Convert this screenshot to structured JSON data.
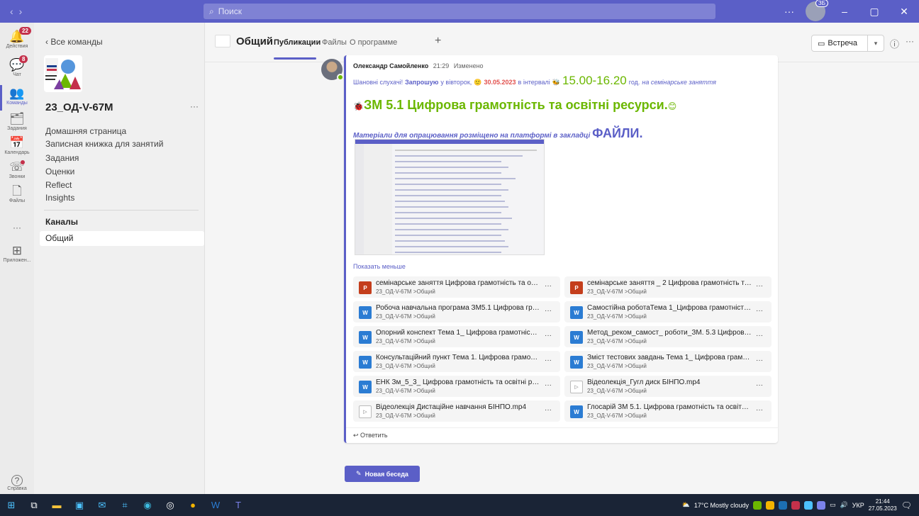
{
  "search": {
    "placeholder": "Поиск"
  },
  "titlebar": {
    "more": "···",
    "avatar_badge": "ЗБ",
    "minimize": "–",
    "maximize": "▢",
    "close": "✕",
    "back": "‹",
    "forward": "›"
  },
  "appbar": [
    {
      "label": "Действия",
      "icon": "bell-icon",
      "glyph": "🔔",
      "count": "22"
    },
    {
      "label": "Чат",
      "icon": "chat-icon",
      "glyph": "💬",
      "count": "8"
    },
    {
      "label": "Команды",
      "icon": "teams-icon",
      "glyph": "👥",
      "active": true
    },
    {
      "label": "Задания",
      "icon": "assignments-icon",
      "glyph": "🗂"
    },
    {
      "label": "Календарь",
      "icon": "calendar-icon",
      "glyph": "📅"
    },
    {
      "label": "Звонки",
      "icon": "phone-icon",
      "glyph": "☏",
      "dot": true
    },
    {
      "label": "Файлы",
      "icon": "file-icon",
      "glyph": "🗋"
    },
    {
      "label": "···",
      "icon": "more-icon",
      "glyph": ""
    },
    {
      "label": "Приложен...",
      "icon": "apps-icon",
      "glyph": "⊞"
    },
    {
      "label": "Справка",
      "icon": "help-icon",
      "glyph": "?"
    }
  ],
  "sidebar": {
    "back": "Все команды",
    "team_name": "23_ОД-V-67М",
    "more": "···",
    "links": [
      "Домашняя страница",
      "Записная книжка для занятий",
      "Задания",
      "Оценки",
      "Reflect",
      "Insights"
    ],
    "channels_heading": "Каналы",
    "channel": "Общий"
  },
  "header": {
    "title": "Общий",
    "tabs": [
      "Публикации",
      "Файлы",
      "О программе"
    ],
    "add": "+",
    "meet": "Встреча",
    "info": "ⓘ",
    "more": "···"
  },
  "message": {
    "author": "Олександр Самойленко",
    "time": "21:29",
    "edited": "Изменено",
    "greeting": "Шановні слухачі!",
    "invite": "Запрошую",
    "on": "у вівторок,",
    "date": "30.05.2023",
    "in": "в інтервалі",
    "hours": "15.00-16.20",
    "hour_suffix": "год.",
    "session": "на семінарське заняття",
    "title": "ЗМ 5.1 Цифрова грамотність та освітні ресурси.",
    "materials": "Матеріали для опрацювання розміщено на платформі в закладці",
    "files_word": "ФАЙЛИ.",
    "show_less": "Показать меньше",
    "reply": "Ответить"
  },
  "files": [
    {
      "type": "ppt",
      "name": "семінарське заняття Цифрова грамотність та осві...",
      "path": "23_ОД-V-67М >Общий"
    },
    {
      "type": "ppt",
      "name": "семінарське заняття _ 2 Цифрова грамотність та о...",
      "path": "23_ОД-V-67М >Общий"
    },
    {
      "type": "word",
      "name": "Робоча навчальна програма ЗМ5.1 Цифрова грам...",
      "path": "23_ОД-V-67М >Общий"
    },
    {
      "type": "word",
      "name": "Самостійна роботаТема 1_Цифрова грамотність т...",
      "path": "23_ОД-V-67М >Общий"
    },
    {
      "type": "word",
      "name": "Опорний конспект Тема 1_ Цифрова грамотність т...",
      "path": "23_ОД-V-67М >Общий"
    },
    {
      "type": "word",
      "name": "Метод_реком_самост_ роботи_ЗМ. 5.3 Цифрова г...",
      "path": "23_ОД-V-67М >Общий"
    },
    {
      "type": "word",
      "name": "Консультаційний пункт Тема 1. Цифрова грамотні...",
      "path": "23_ОД-V-67М >Общий"
    },
    {
      "type": "word",
      "name": "Зміст тестових завдань Тема 1_ Цифрова грамотні...",
      "path": "23_ОД-V-67М >Общий"
    },
    {
      "type": "word",
      "name": "ЕНК Зм_5_3_ Цифрова грамотність та освітні ресу...",
      "path": "23_ОД-V-67М >Общий"
    },
    {
      "type": "vid",
      "name": "Відеолекція_Гугл диск БІНПО.mp4",
      "path": "23_ОД-V-67М >Общий"
    },
    {
      "type": "vid",
      "name": "Відеолекція Дистаційне навчання БІНПО.mp4",
      "path": "23_ОД-V-67М >Общий"
    },
    {
      "type": "word",
      "name": "Глосарій ЗМ 5.1. Цифрова грамотність та освітні р...",
      "path": "23_ОД-V-67М >Общий"
    }
  ],
  "file_more": "···",
  "new_conversation": "Новая беседа",
  "taskbar": {
    "weather": "17°C  Mostly cloudy",
    "lang": "УКР",
    "time": "21:44",
    "date": "27.05.2023"
  },
  "colors": {
    "accent": "#5b5fc7",
    "green": "#6bb700",
    "red": "#c4314b"
  }
}
